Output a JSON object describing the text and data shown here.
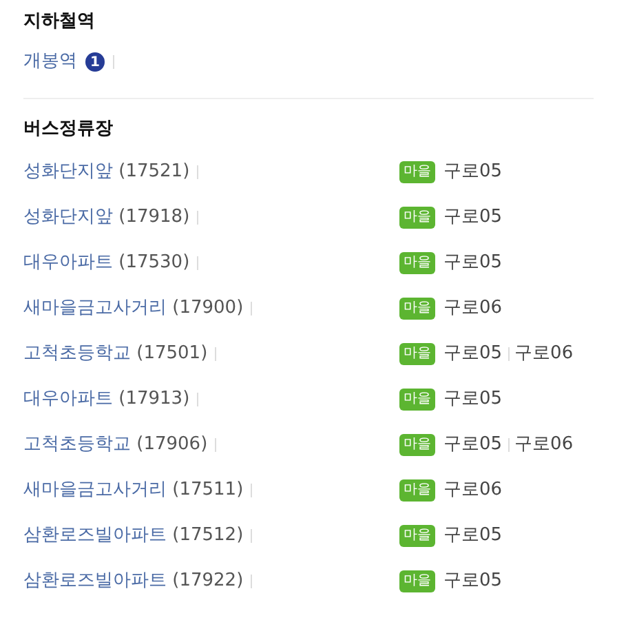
{
  "subway": {
    "title": "지하철역",
    "stations": [
      {
        "name": "개봉역",
        "line": "1"
      }
    ]
  },
  "bus": {
    "title": "버스정류장",
    "stops": [
      {
        "name": "성화단지앞",
        "code": "(17521)",
        "badge": "마을",
        "routes": [
          "구로05"
        ]
      },
      {
        "name": "성화단지앞",
        "code": "(17918)",
        "badge": "마을",
        "routes": [
          "구로05"
        ]
      },
      {
        "name": "대우아파트",
        "code": "(17530)",
        "badge": "마을",
        "routes": [
          "구로05"
        ]
      },
      {
        "name": "새마을금고사거리",
        "code": "(17900)",
        "badge": "마을",
        "routes": [
          "구로06"
        ]
      },
      {
        "name": "고척초등학교",
        "code": "(17501)",
        "badge": "마을",
        "routes": [
          "구로05",
          "구로06"
        ]
      },
      {
        "name": "대우아파트",
        "code": "(17913)",
        "badge": "마을",
        "routes": [
          "구로05"
        ]
      },
      {
        "name": "고척초등학교",
        "code": "(17906)",
        "badge": "마을",
        "routes": [
          "구로05",
          "구로06"
        ]
      },
      {
        "name": "새마을금고사거리",
        "code": "(17511)",
        "badge": "마을",
        "routes": [
          "구로06"
        ]
      },
      {
        "name": "삼환로즈빌아파트",
        "code": "(17512)",
        "badge": "마을",
        "routes": [
          "구로05"
        ]
      },
      {
        "name": "삼환로즈빌아파트",
        "code": "(17922)",
        "badge": "마을",
        "routes": [
          "구로05"
        ]
      }
    ]
  }
}
